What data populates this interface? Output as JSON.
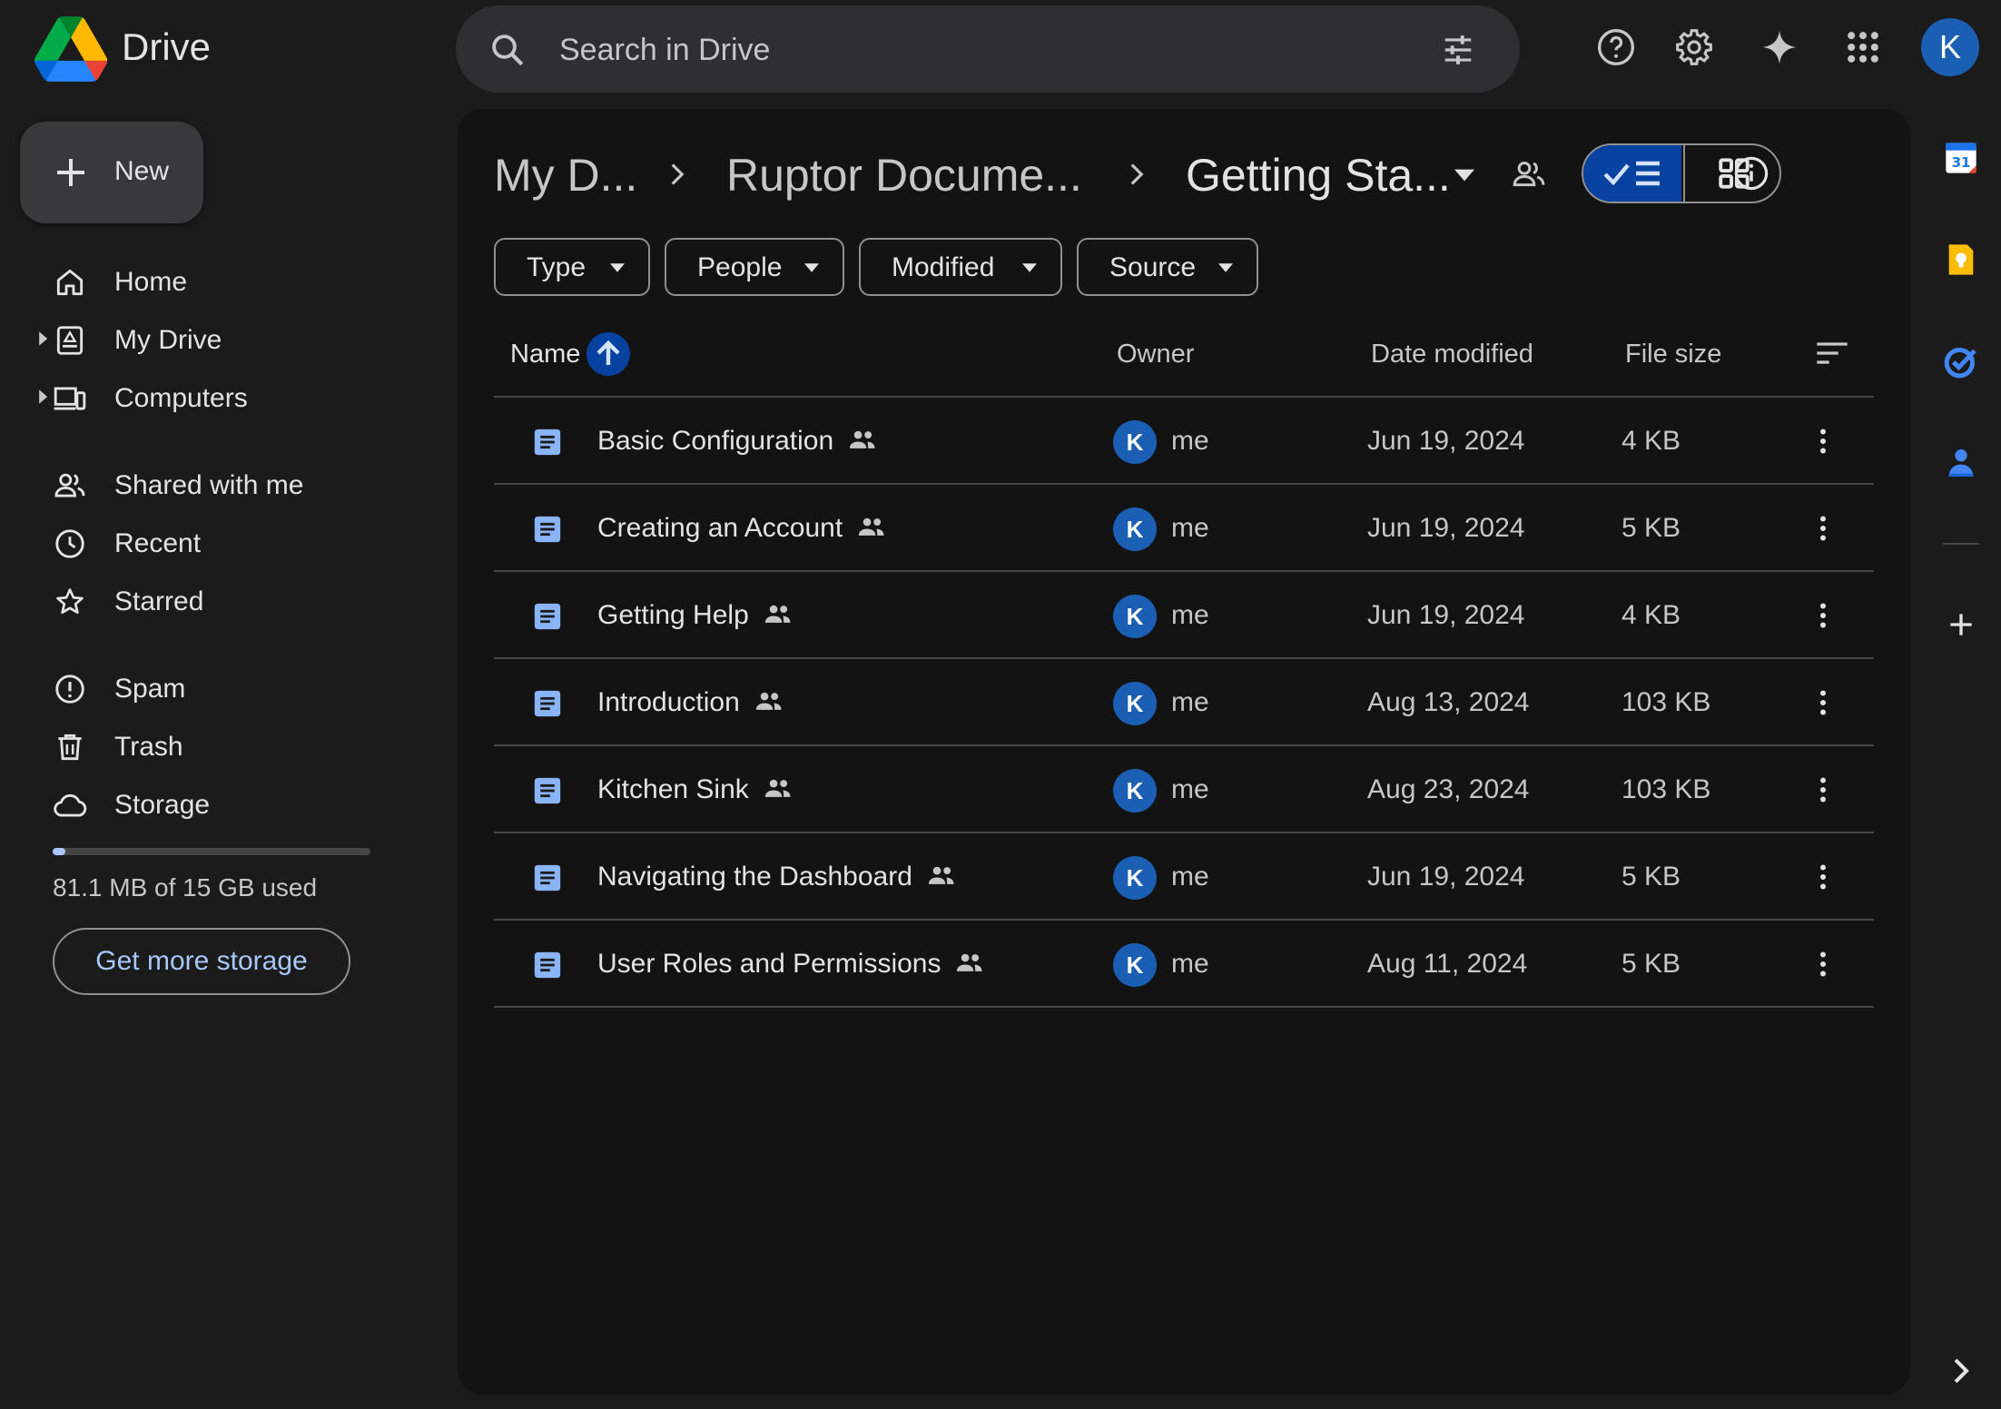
{
  "app": {
    "name": "Drive"
  },
  "search": {
    "placeholder": "Search in Drive"
  },
  "account": {
    "initial": "K"
  },
  "sidebar": {
    "new_label": "New",
    "items": [
      {
        "label": "Home"
      },
      {
        "label": "My Drive"
      },
      {
        "label": "Computers"
      },
      {
        "label": "Shared with me"
      },
      {
        "label": "Recent"
      },
      {
        "label": "Starred"
      },
      {
        "label": "Spam"
      },
      {
        "label": "Trash"
      },
      {
        "label": "Storage"
      }
    ],
    "storage": {
      "used_text": "81.1 MB of 15 GB used",
      "fraction_used": 0.0054,
      "button": "Get more storage"
    }
  },
  "breadcrumb": [
    "My D...",
    "Ruptor Docume...",
    "Getting Sta..."
  ],
  "filters": [
    "Type",
    "People",
    "Modified",
    "Source"
  ],
  "columns": {
    "name": "Name",
    "owner": "Owner",
    "date": "Date modified",
    "size": "File size"
  },
  "files": [
    {
      "name": "Basic Configuration",
      "owner": "me",
      "owner_initial": "K",
      "date": "Jun 19, 2024",
      "size": "4 KB"
    },
    {
      "name": "Creating an Account",
      "owner": "me",
      "owner_initial": "K",
      "date": "Jun 19, 2024",
      "size": "5 KB"
    },
    {
      "name": "Getting Help",
      "owner": "me",
      "owner_initial": "K",
      "date": "Jun 19, 2024",
      "size": "4 KB"
    },
    {
      "name": "Introduction",
      "owner": "me",
      "owner_initial": "K",
      "date": "Aug 13, 2024",
      "size": "103 KB"
    },
    {
      "name": "Kitchen Sink",
      "owner": "me",
      "owner_initial": "K",
      "date": "Aug 23, 2024",
      "size": "103 KB"
    },
    {
      "name": "Navigating the Dashboard",
      "owner": "me",
      "owner_initial": "K",
      "date": "Jun 19, 2024",
      "size": "5 KB"
    },
    {
      "name": "User Roles and Permissions",
      "owner": "me",
      "owner_initial": "K",
      "date": "Aug 11, 2024",
      "size": "5 KB"
    }
  ],
  "colors": {
    "accent": "#a8c7fa",
    "selected_toggle": "#0842a0",
    "avatar": "#1a5fb4",
    "doc_icon": "#8ab4f8"
  }
}
